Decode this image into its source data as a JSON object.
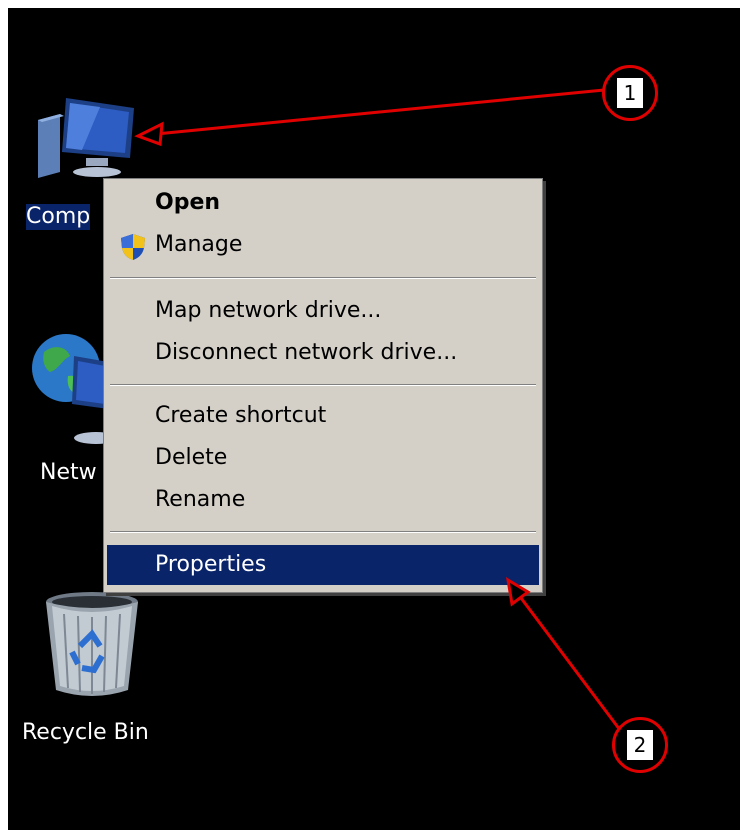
{
  "desktop": {
    "icons": [
      {
        "name": "computer",
        "label": "Comp",
        "selected": true
      },
      {
        "name": "network",
        "label": "Netw"
      },
      {
        "name": "recycle-bin",
        "label": "Recycle Bin"
      }
    ]
  },
  "context_menu": {
    "items": [
      {
        "id": "open",
        "label": "Open",
        "bold": true
      },
      {
        "id": "manage",
        "label": "Manage",
        "icon": "shield-icon"
      },
      {
        "id": "map",
        "label": "Map network drive..."
      },
      {
        "id": "disconnect",
        "label": "Disconnect network drive..."
      },
      {
        "id": "shortcut",
        "label": "Create shortcut"
      },
      {
        "id": "delete",
        "label": "Delete"
      },
      {
        "id": "rename",
        "label": "Rename"
      },
      {
        "id": "properties",
        "label": "Properties",
        "highlighted": true
      }
    ]
  },
  "annotations": [
    {
      "number": "1"
    },
    {
      "number": "2"
    }
  ],
  "colors": {
    "highlight": "#0a246a",
    "menu_background": "#d4d0c8",
    "annotation": "#e00000"
  }
}
